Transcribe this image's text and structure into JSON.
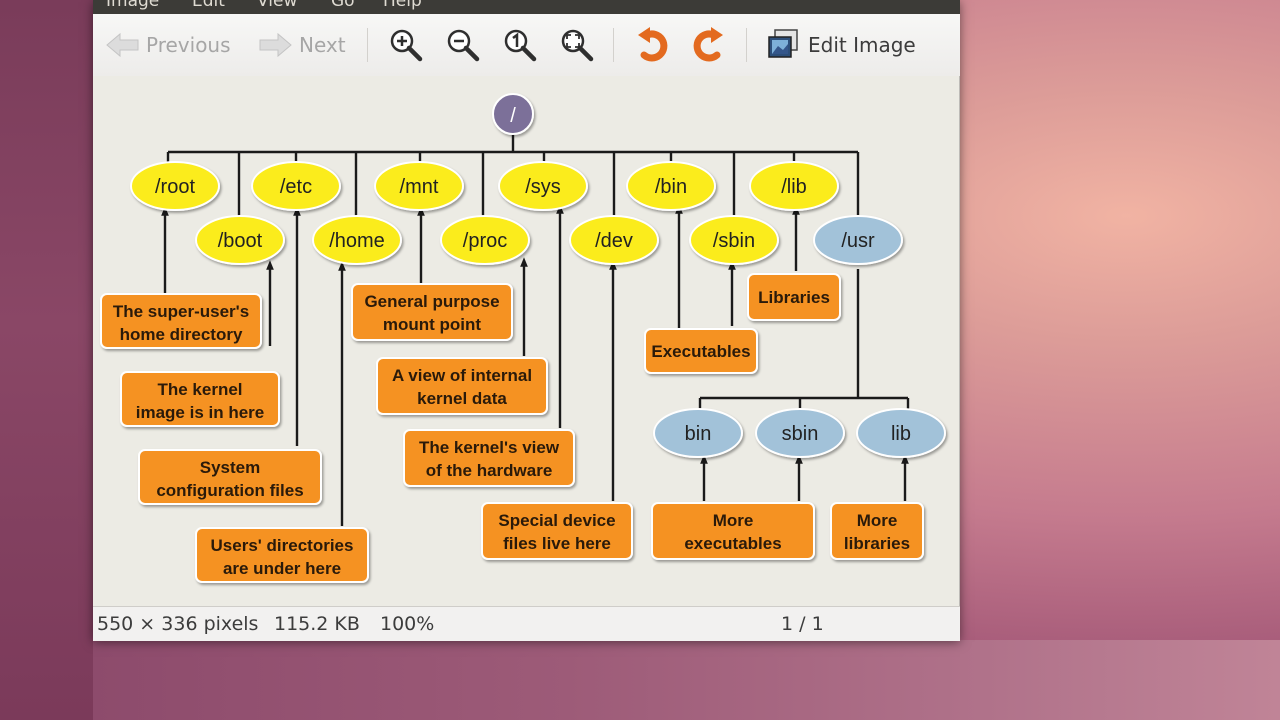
{
  "menubar": {
    "items": [
      "Image",
      "Edit",
      "View",
      "Go",
      "Help"
    ]
  },
  "toolbar": {
    "previous_label": "Previous",
    "next_label": "Next",
    "edit_image_label": "Edit Image",
    "icons": [
      "arrow-left-icon",
      "arrow-right-icon",
      "zoom-in-icon",
      "zoom-out-icon",
      "zoom-normal-icon",
      "zoom-fit-icon",
      "rotate-left-icon",
      "rotate-right-icon",
      "edit-image-icon"
    ]
  },
  "diagram": {
    "root": "/",
    "directories": {
      "root": "/root",
      "boot": "/boot",
      "etc": "/etc",
      "home": "/home",
      "mnt": "/mnt",
      "proc": "/proc",
      "sys": "/sys",
      "dev": "/dev",
      "bin": "/bin",
      "sbin": "/sbin",
      "lib": "/lib",
      "usr": "/usr",
      "usr_bin": "bin",
      "usr_sbin": "sbin",
      "usr_lib": "lib"
    },
    "descriptions": {
      "root": [
        "The super-user's",
        "home directory"
      ],
      "boot": [
        "The kernel",
        "image is in here"
      ],
      "etc": [
        "System",
        "configuration files"
      ],
      "home": [
        "Users' directories",
        "are under here"
      ],
      "mnt": [
        "General purpose",
        "mount point"
      ],
      "proc": [
        "A view of internal",
        "kernel data"
      ],
      "sys": [
        "The kernel's view",
        "of the hardware"
      ],
      "dev": [
        "Special device",
        "files live here"
      ],
      "bin_sbin": [
        "Executables"
      ],
      "lib": [
        "Libraries"
      ],
      "usr_bin_sbin": [
        "More",
        "executables"
      ],
      "usr_lib": [
        "More",
        "libraries"
      ]
    },
    "colors": {
      "root_node": "#7b6f99",
      "dir_node": "#fbec1b",
      "usr_node": "#a2c2d9",
      "label_box": "#f59223"
    }
  },
  "statusbar": {
    "dimensions": "550 × 336 pixels",
    "size": "115.2 KB",
    "zoom": "100%",
    "page": "1 / 1"
  }
}
